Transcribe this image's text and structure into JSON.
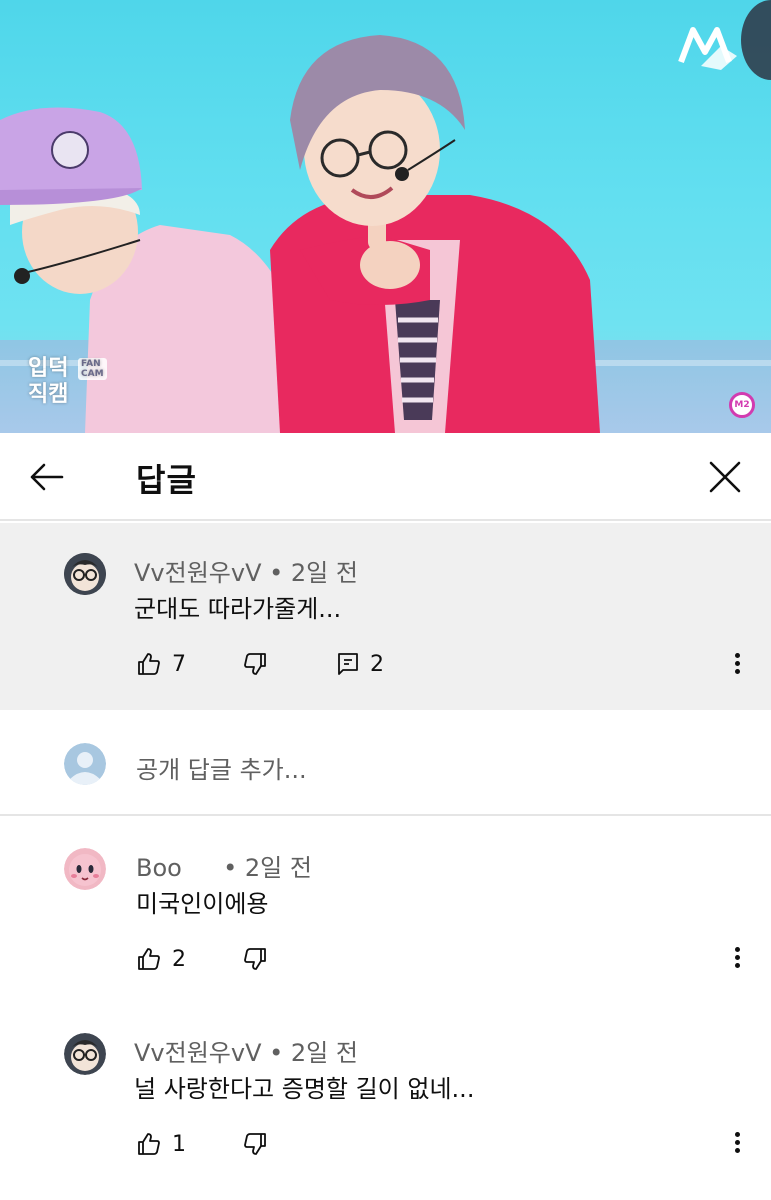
{
  "video": {
    "channel_logo_icon": "m2-logo",
    "fancam_label_line1": "입덕",
    "fancam_label_line2": "직캠",
    "fancam_badge": "FAN CAM",
    "corner_badge": "M2"
  },
  "header": {
    "title": "답글",
    "back_icon": "arrow-left-icon",
    "close_icon": "close-icon"
  },
  "parent_comment": {
    "author": "Vv전원우vV",
    "time": "• 2일 전",
    "text": "군대도 따라가줄게...",
    "likes": "7",
    "replies": "2"
  },
  "add_reply": {
    "placeholder": "공개 답글 추가..."
  },
  "replies": [
    {
      "author": "Boo",
      "time": "• 2일 전",
      "text": "미국인이에용",
      "likes": "2"
    },
    {
      "author": "Vv전원우vV",
      "time": "• 2일 전",
      "text": "널 사랑한다고 증명할 길이 없네...",
      "likes": "1"
    }
  ],
  "colors": {
    "text_primary": "#0f0f0f",
    "text_secondary": "#606060",
    "highlight_bg": "#f0f0f0",
    "divider": "#e5e5e5"
  }
}
